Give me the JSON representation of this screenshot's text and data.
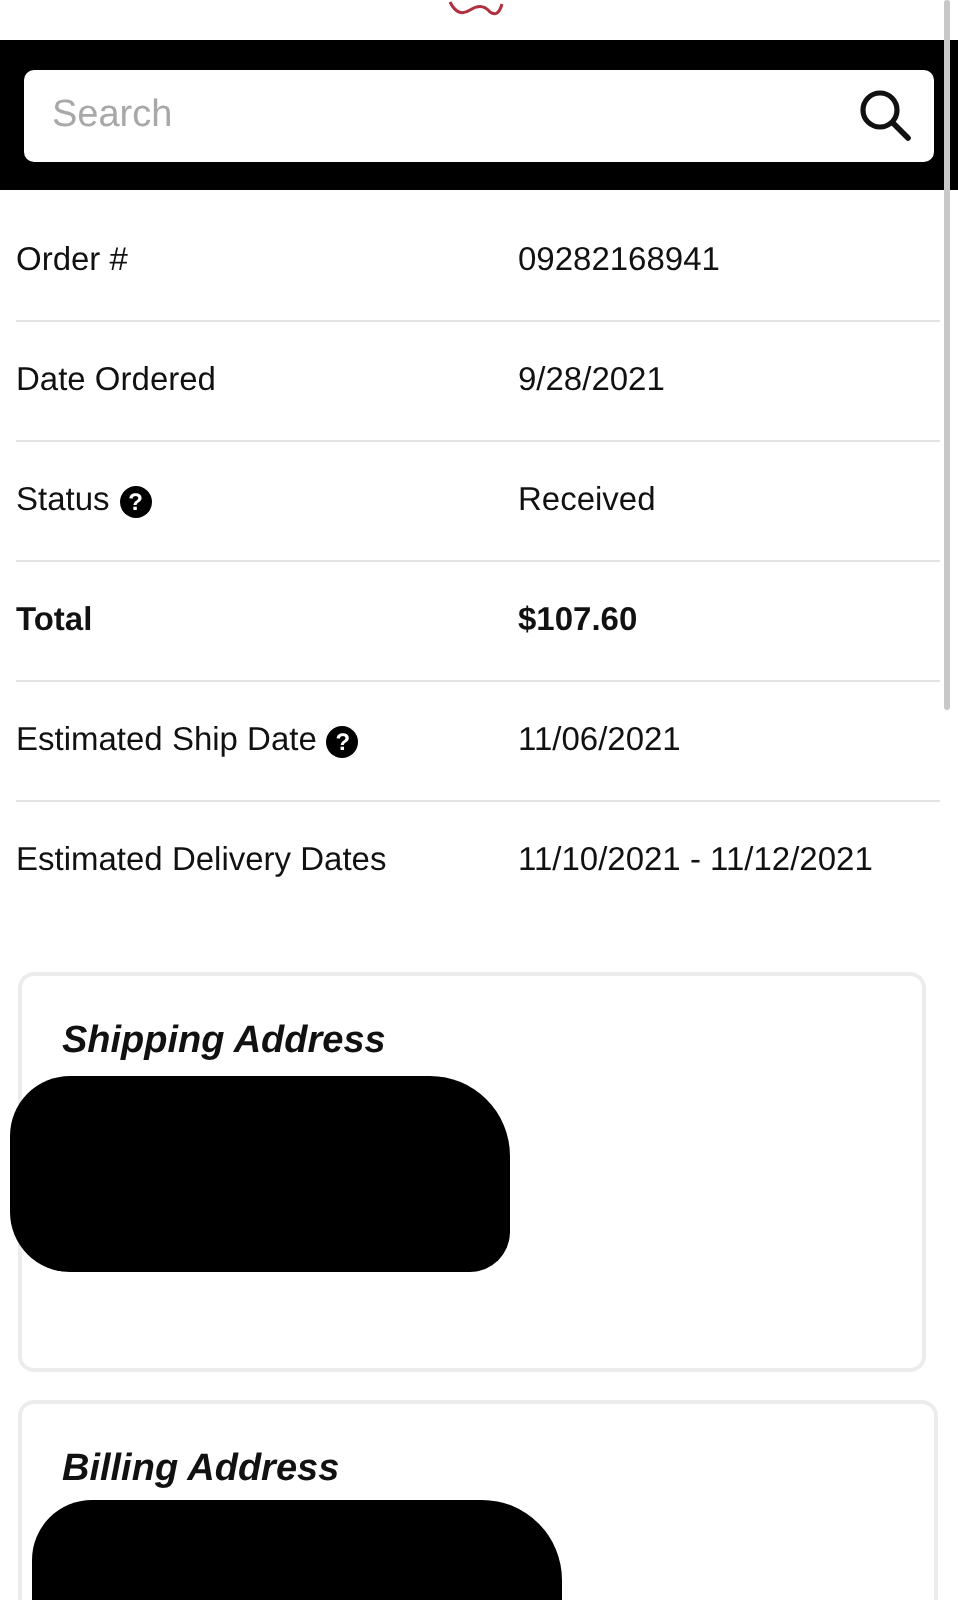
{
  "search": {
    "placeholder": "Search"
  },
  "order_details": [
    {
      "label": "Order #",
      "value": "09282168941",
      "bold": false
    },
    {
      "label": "Date Ordered",
      "value": "9/28/2021",
      "bold": false
    },
    {
      "label": "Status",
      "value": "Received",
      "bold": false,
      "help": "?"
    },
    {
      "label": "Total",
      "value": "$107.60",
      "bold": true
    },
    {
      "label": "Estimated Ship Date",
      "value": "11/06/2021",
      "bold": false,
      "help": "?"
    },
    {
      "label": "Estimated Delivery Dates",
      "value": "11/10/2021 - 11/12/2021",
      "bold": false
    }
  ],
  "address_cards": [
    {
      "title": "Shipping Address",
      "redacted": true
    },
    {
      "title": "Billing Address",
      "redacted": true
    }
  ]
}
